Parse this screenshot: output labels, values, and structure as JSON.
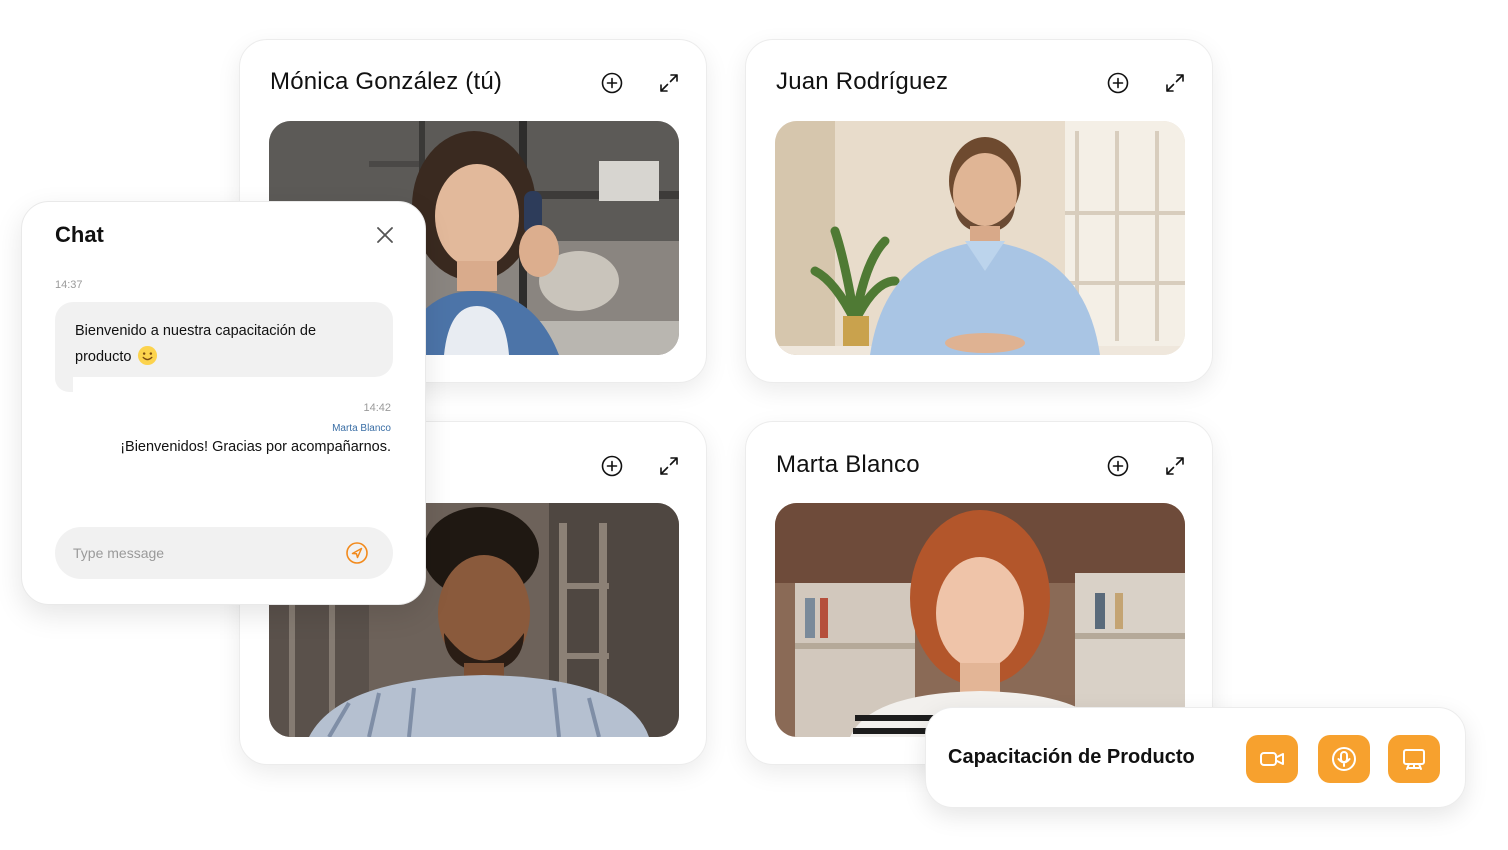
{
  "participants": [
    {
      "name": "Mónica González (tú)"
    },
    {
      "name": "Juan Rodríguez"
    },
    {
      "name": ""
    },
    {
      "name": "Marta Blanco"
    }
  ],
  "icons": {
    "add": "plus-circle-icon",
    "expand": "expand-icon",
    "close": "close-icon",
    "send": "send-icon",
    "camera": "video-camera-icon",
    "mic": "microphone-icon",
    "share": "screen-share-icon"
  },
  "chat": {
    "title": "Chat",
    "messages": [
      {
        "time": "14:37",
        "text": "Bienvenido a nuestra capacitación de producto",
        "emoji": "smile"
      },
      {
        "time": "14:42",
        "sender": "Marta Blanco",
        "text": "¡Bienvenidos! Gracias por acompañarnos."
      }
    ],
    "input_placeholder": "Type message"
  },
  "meeting": {
    "title": "Capacitación de Producto"
  },
  "colors": {
    "accent": "#f7a12e",
    "sender_name": "#3a6ea5",
    "bubble": "#f1f1f1"
  }
}
